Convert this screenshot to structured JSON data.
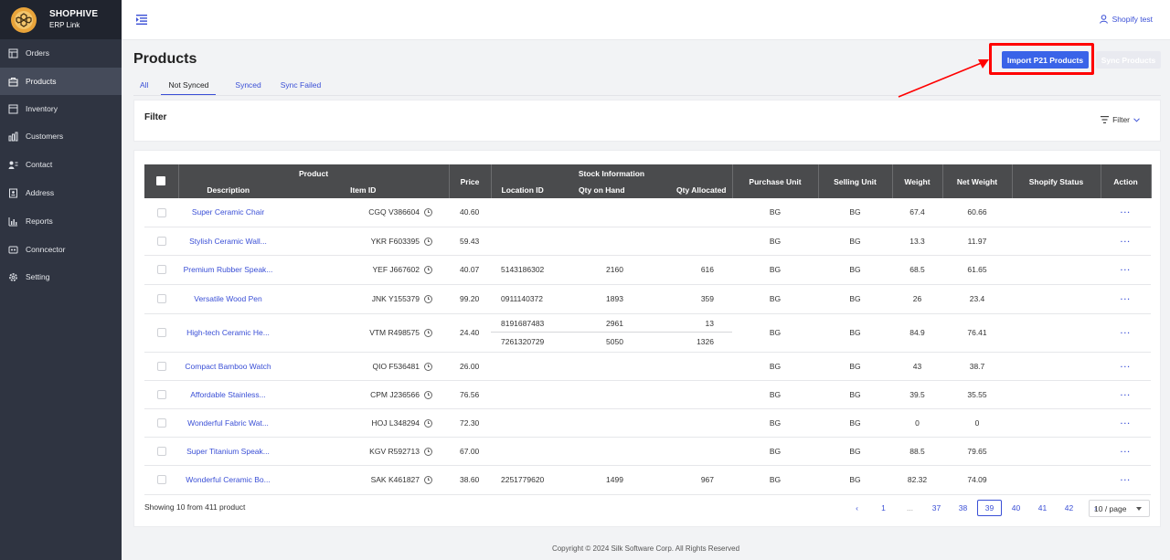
{
  "brand": {
    "name": "SHOPHIVE",
    "sub": "ERP Link"
  },
  "nav": [
    {
      "label": "Orders",
      "icon": "orders-icon"
    },
    {
      "label": "Products",
      "icon": "products-icon",
      "active": true
    },
    {
      "label": "Inventory",
      "icon": "inventory-icon"
    },
    {
      "label": "Customers",
      "icon": "customers-icon"
    },
    {
      "label": "Contact",
      "icon": "contact-icon"
    },
    {
      "label": "Address",
      "icon": "address-icon"
    },
    {
      "label": "Reports",
      "icon": "reports-icon"
    },
    {
      "label": "Conncector",
      "icon": "connector-icon"
    },
    {
      "label": "Setting",
      "icon": "gear-icon"
    }
  ],
  "header": {
    "user": "Shopify test"
  },
  "page": {
    "title": "Products",
    "tabs": [
      {
        "label": "All"
      },
      {
        "label": "Not Synced",
        "active": true
      },
      {
        "label": "Synced"
      },
      {
        "label": "Sync Failed"
      }
    ],
    "import_button": "Import P21 Products",
    "sync_button": "Sync Products"
  },
  "filter": {
    "title": "Filter",
    "button": "Filter"
  },
  "table": {
    "group_product": "Product",
    "group_stock": "Stock Information",
    "col_description": "Description",
    "col_item_id": "Item ID",
    "col_price": "Price",
    "col_location": "Location ID",
    "col_qty_hand": "Qty on Hand",
    "col_qty_alloc": "Qty Allocated",
    "col_purchase_unit": "Purchase Unit",
    "col_selling_unit": "Selling Unit",
    "col_weight": "Weight",
    "col_net_weight": "Net Weight",
    "col_shopify_status": "Shopify Status",
    "col_action": "Action",
    "rows": [
      {
        "desc": "Super Ceramic Chair",
        "item": "CGQ V386604",
        "price": "40.60",
        "stock": [],
        "pu": "BG",
        "su": "BG",
        "weight": "67.4",
        "net": "60.66",
        "status": "",
        "action": "···"
      },
      {
        "desc": "Stylish Ceramic Wall...",
        "item": "YKR F603395",
        "price": "59.43",
        "stock": [],
        "pu": "BG",
        "su": "BG",
        "weight": "13.3",
        "net": "11.97",
        "status": "",
        "action": "···"
      },
      {
        "desc": "Premium Rubber Speak...",
        "item": "YEF J667602",
        "price": "40.07",
        "stock": [
          {
            "loc": "5143186302",
            "hand": "2160",
            "alloc": "616"
          }
        ],
        "pu": "BG",
        "su": "BG",
        "weight": "68.5",
        "net": "61.65",
        "status": "",
        "action": "···"
      },
      {
        "desc": "Versatile Wood Pen",
        "item": "JNK Y155379",
        "price": "99.20",
        "stock": [
          {
            "loc": "0911140372",
            "hand": "1893",
            "alloc": "359"
          }
        ],
        "pu": "BG",
        "su": "BG",
        "weight": "26",
        "net": "23.4",
        "status": "",
        "action": "···"
      },
      {
        "desc": "High-tech Ceramic He...",
        "item": "VTM R498575",
        "price": "24.40",
        "stock": [
          {
            "loc": "8191687483",
            "hand": "2961",
            "alloc": "13"
          },
          {
            "loc": "7261320729",
            "hand": "5050",
            "alloc": "1326"
          }
        ],
        "pu": "BG",
        "su": "BG",
        "weight": "84.9",
        "net": "76.41",
        "status": "",
        "action": "···"
      },
      {
        "desc": "Compact Bamboo Watch",
        "item": "QIO F536481",
        "price": "26.00",
        "stock": [],
        "pu": "BG",
        "su": "BG",
        "weight": "43",
        "net": "38.7",
        "status": "",
        "action": "···"
      },
      {
        "desc": "Affordable Stainless...",
        "item": "CPM J236566",
        "price": "76.56",
        "stock": [],
        "pu": "BG",
        "su": "BG",
        "weight": "39.5",
        "net": "35.55",
        "status": "",
        "action": "···"
      },
      {
        "desc": "Wonderful Fabric Wat...",
        "item": "HOJ L348294",
        "price": "72.30",
        "stock": [],
        "pu": "BG",
        "su": "BG",
        "weight": "0",
        "net": "0",
        "status": "",
        "action": "···"
      },
      {
        "desc": "Super Titanium Speak...",
        "item": "KGV R592713",
        "price": "67.00",
        "stock": [],
        "pu": "BG",
        "su": "BG",
        "weight": "88.5",
        "net": "79.65",
        "status": "",
        "action": "···"
      },
      {
        "desc": "Wonderful Ceramic Bo...",
        "item": "SAK K461827",
        "price": "38.60",
        "stock": [
          {
            "loc": "2251779620",
            "hand": "1499",
            "alloc": "967"
          }
        ],
        "pu": "BG",
        "su": "BG",
        "weight": "82.32",
        "net": "74.09",
        "status": "",
        "action": "···"
      }
    ]
  },
  "pagination": {
    "showing": "Showing 10 from 411 product",
    "prev": "‹",
    "next": "›",
    "pages": [
      "1",
      "...",
      "37",
      "38",
      "39",
      "40",
      "41",
      "42"
    ],
    "current": "39",
    "page_size": "10 / page"
  },
  "footer": "Copyright © 2024 Silk Software Corp. All Rights Reserved",
  "colors": {
    "accent": "#3a63e8",
    "sidebar": "#2f3441",
    "highlight": "#ff0000",
    "header_bg": "#4a4b4d"
  }
}
